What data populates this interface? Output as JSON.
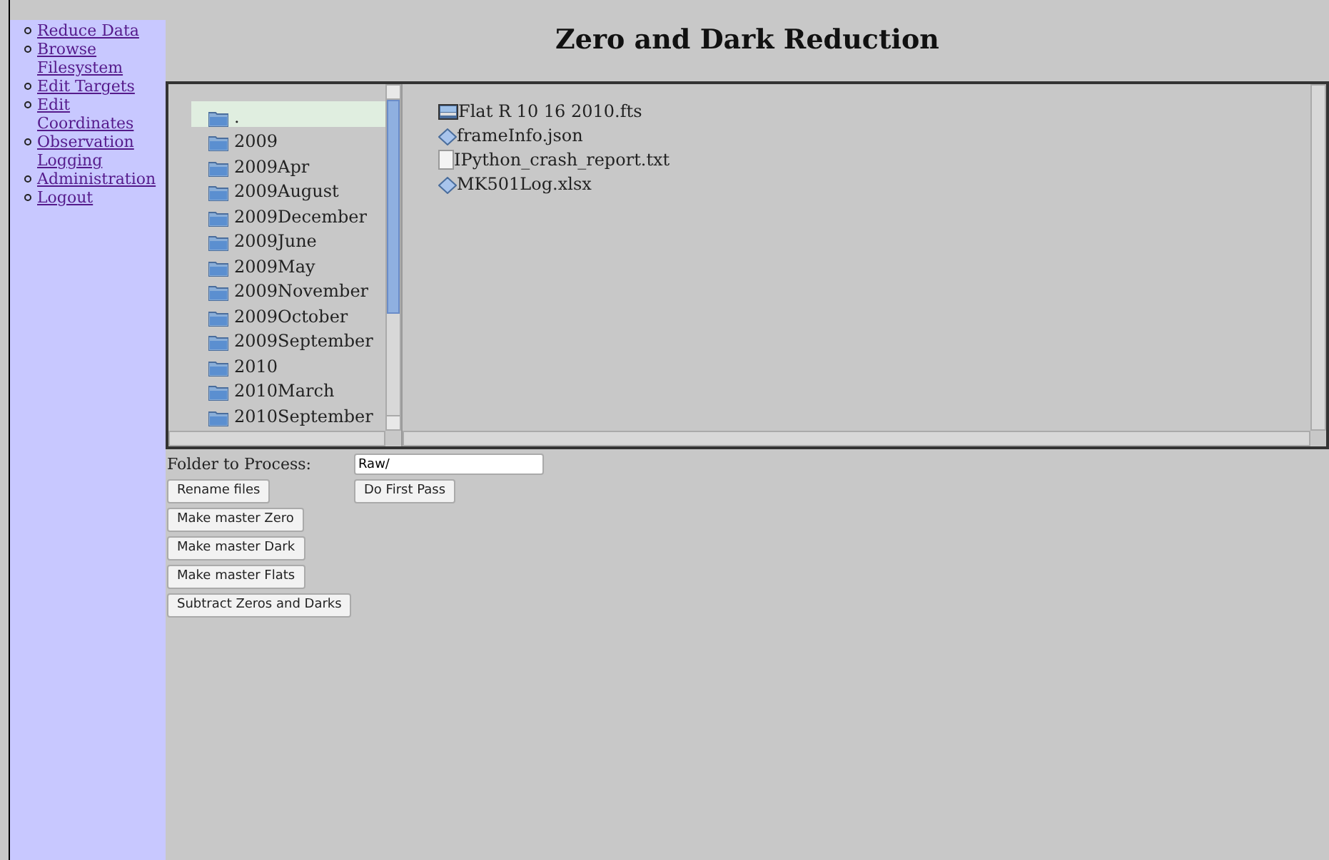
{
  "sidebar": {
    "items": [
      {
        "label": "Reduce Data"
      },
      {
        "label": "Browse Filesystem"
      },
      {
        "label": "Edit Targets"
      },
      {
        "label": "Edit Coordinates"
      },
      {
        "label": "Observation Logging"
      },
      {
        "label": "Administration"
      },
      {
        "label": "Logout"
      }
    ]
  },
  "title": "Zero and Dark Reduction",
  "folders": [
    {
      "name": ".",
      "selected": true
    },
    {
      "name": "2009",
      "selected": false
    },
    {
      "name": "2009Apr",
      "selected": false
    },
    {
      "name": "2009August",
      "selected": false
    },
    {
      "name": "2009December",
      "selected": false
    },
    {
      "name": "2009June",
      "selected": false
    },
    {
      "name": "2009May",
      "selected": false
    },
    {
      "name": "2009November",
      "selected": false
    },
    {
      "name": "2009October",
      "selected": false
    },
    {
      "name": "2009September",
      "selected": false
    },
    {
      "name": "2010",
      "selected": false
    },
    {
      "name": "2010March",
      "selected": false
    },
    {
      "name": "2010September",
      "selected": false
    }
  ],
  "files": [
    {
      "name": "Flat R 10 16 2010.fts",
      "kind": "image"
    },
    {
      "name": "frameInfo.json",
      "kind": "diamond"
    },
    {
      "name": "IPython_crash_report.txt",
      "kind": "text"
    },
    {
      "name": "MK501Log.xlsx",
      "kind": "diamond"
    }
  ],
  "form": {
    "label": "Folder to Process:",
    "value": "Raw/"
  },
  "buttons_left": [
    "Rename files",
    "Make master Zero",
    "Make master Dark",
    "Make master Flats",
    "Subtract Zeros and Darks"
  ],
  "buttons_right": [
    "Do First Pass"
  ]
}
